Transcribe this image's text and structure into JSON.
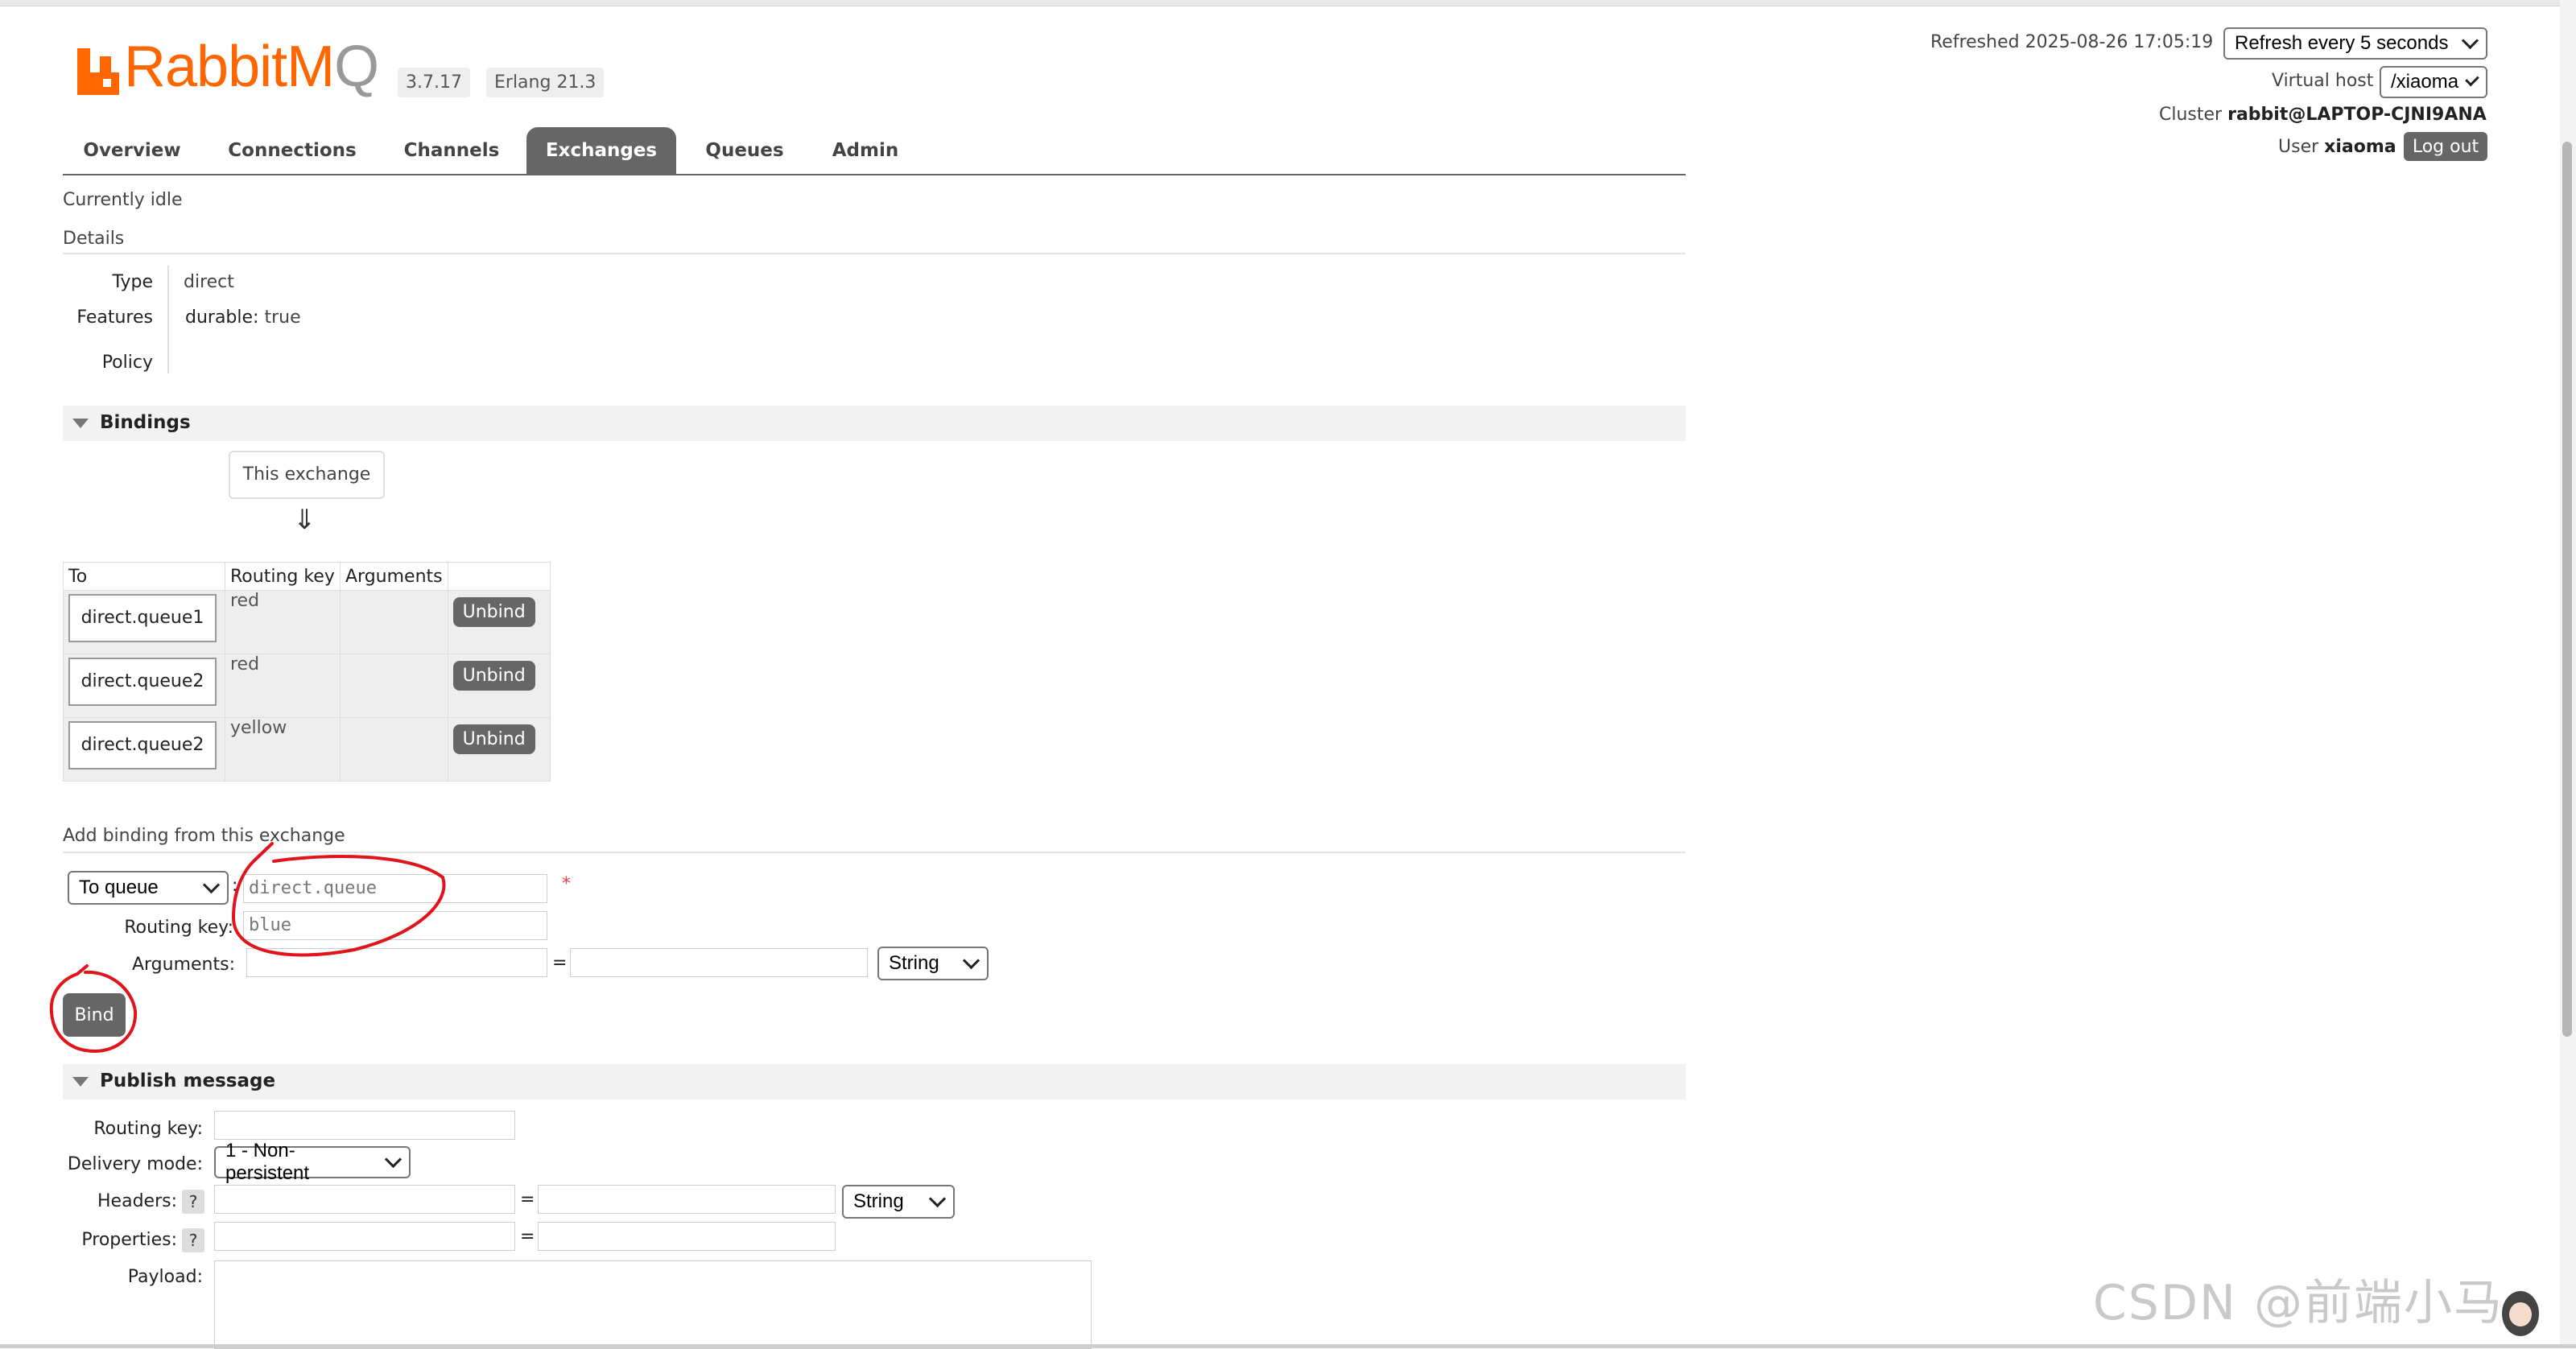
{
  "header": {
    "logo_text_rabbit": "RabbitM",
    "logo_text_q": "Q",
    "version": "3.7.17",
    "erlang": "Erlang 21.3",
    "refreshed": "Refreshed 2025-08-26 17:05:19",
    "refresh_select": "Refresh every 5 seconds",
    "virtual_host_label": "Virtual host",
    "virtual_host_value": "/xiaoma",
    "cluster_label": "Cluster",
    "cluster_value": "rabbit@LAPTOP-CJNI9ANA",
    "user_label": "User",
    "user_value": "xiaoma",
    "logout": "Log out"
  },
  "tabs": [
    {
      "label": "Overview"
    },
    {
      "label": "Connections"
    },
    {
      "label": "Channels"
    },
    {
      "label": "Exchanges",
      "active": true
    },
    {
      "label": "Queues"
    },
    {
      "label": "Admin"
    }
  ],
  "status": "Currently idle",
  "details": {
    "heading": "Details",
    "type_label": "Type",
    "type_value": "direct",
    "features_label": "Features",
    "features_key": "durable:",
    "features_value": "true",
    "policy_label": "Policy"
  },
  "bindings": {
    "heading": "Bindings",
    "this_exchange": "This exchange",
    "arrow": "⇓",
    "columns": [
      "To",
      "Routing key",
      "Arguments"
    ],
    "rows": [
      {
        "to": "direct.queue1",
        "routing_key": "red",
        "action": "Unbind"
      },
      {
        "to": "direct.queue2",
        "routing_key": "red",
        "action": "Unbind"
      },
      {
        "to": "direct.queue2",
        "routing_key": "yellow",
        "action": "Unbind"
      }
    ]
  },
  "add_binding": {
    "heading": "Add binding from this exchange",
    "dest_select": "To queue",
    "colon": ":",
    "dest_value": "direct.queue",
    "required": "*",
    "routing_key_label": "Routing key:",
    "routing_key_value": "blue",
    "arguments_label": "Arguments:",
    "equals": "=",
    "type_select": "String",
    "bind_button": "Bind"
  },
  "publish": {
    "heading": "Publish message",
    "routing_key_label": "Routing key:",
    "delivery_mode_label": "Delivery mode:",
    "delivery_mode_value": "1 - Non-persistent",
    "headers_label": "Headers:",
    "help": "?",
    "equals": "=",
    "headers_type": "String",
    "properties_label": "Properties:",
    "payload_label": "Payload:"
  },
  "watermark": "CSDN @前端小马",
  "colors": {
    "brand": "#ff6600",
    "tab_active": "#666666",
    "annotation": "#e0141b"
  }
}
